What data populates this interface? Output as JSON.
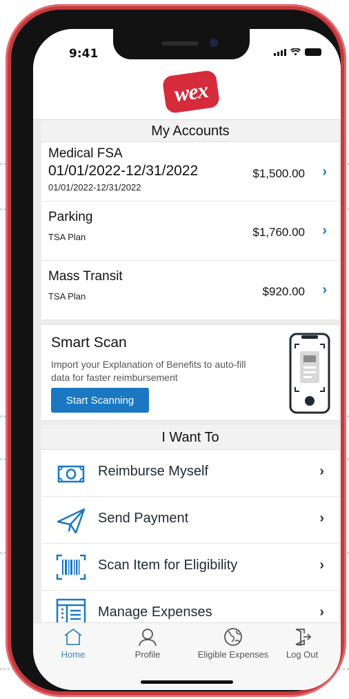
{
  "status_bar": {
    "time": "9:41"
  },
  "brand": {
    "logo_text": "wex"
  },
  "accounts": {
    "title": "My Accounts",
    "items": [
      {
        "name": "Medical FSA",
        "dates": "01/01/2022-12/31/2022",
        "sub": "01/01/2022-12/31/2022",
        "amount": "$1,500.00"
      },
      {
        "name": "Parking",
        "sub": "TSA Plan",
        "amount": "$1,760.00"
      },
      {
        "name": "Mass Transit",
        "sub": "TSA Plan",
        "amount": "$920.00"
      }
    ],
    "chevron": "›"
  },
  "smart_scan": {
    "title": "Smart Scan",
    "description": "Import your Explanation of Benefits to auto-fill data for faster reimbursement",
    "button_label": "Start Scanning"
  },
  "i_want_to": {
    "title": "I Want To",
    "items": [
      {
        "label": "Reimburse Myself",
        "icon": "cash-icon"
      },
      {
        "label": "Send Payment",
        "icon": "paper-plane-icon"
      },
      {
        "label": "Scan Item for Eligibility",
        "icon": "barcode-icon"
      },
      {
        "label": "Manage Expenses",
        "icon": "expenses-list-icon"
      }
    ],
    "chevron": "›"
  },
  "tabs": [
    {
      "label": "Home",
      "icon": "home-icon",
      "active": true
    },
    {
      "label": "Profile",
      "icon": "profile-icon",
      "active": false
    },
    {
      "label": "Eligible Expenses",
      "icon": "globe-icon",
      "active": false
    },
    {
      "label": "Log Out",
      "icon": "logout-icon",
      "active": false
    }
  ],
  "colors": {
    "accent": "#1a78c2",
    "brand": "#d52b3a",
    "phone_frame": "#c8383d"
  }
}
